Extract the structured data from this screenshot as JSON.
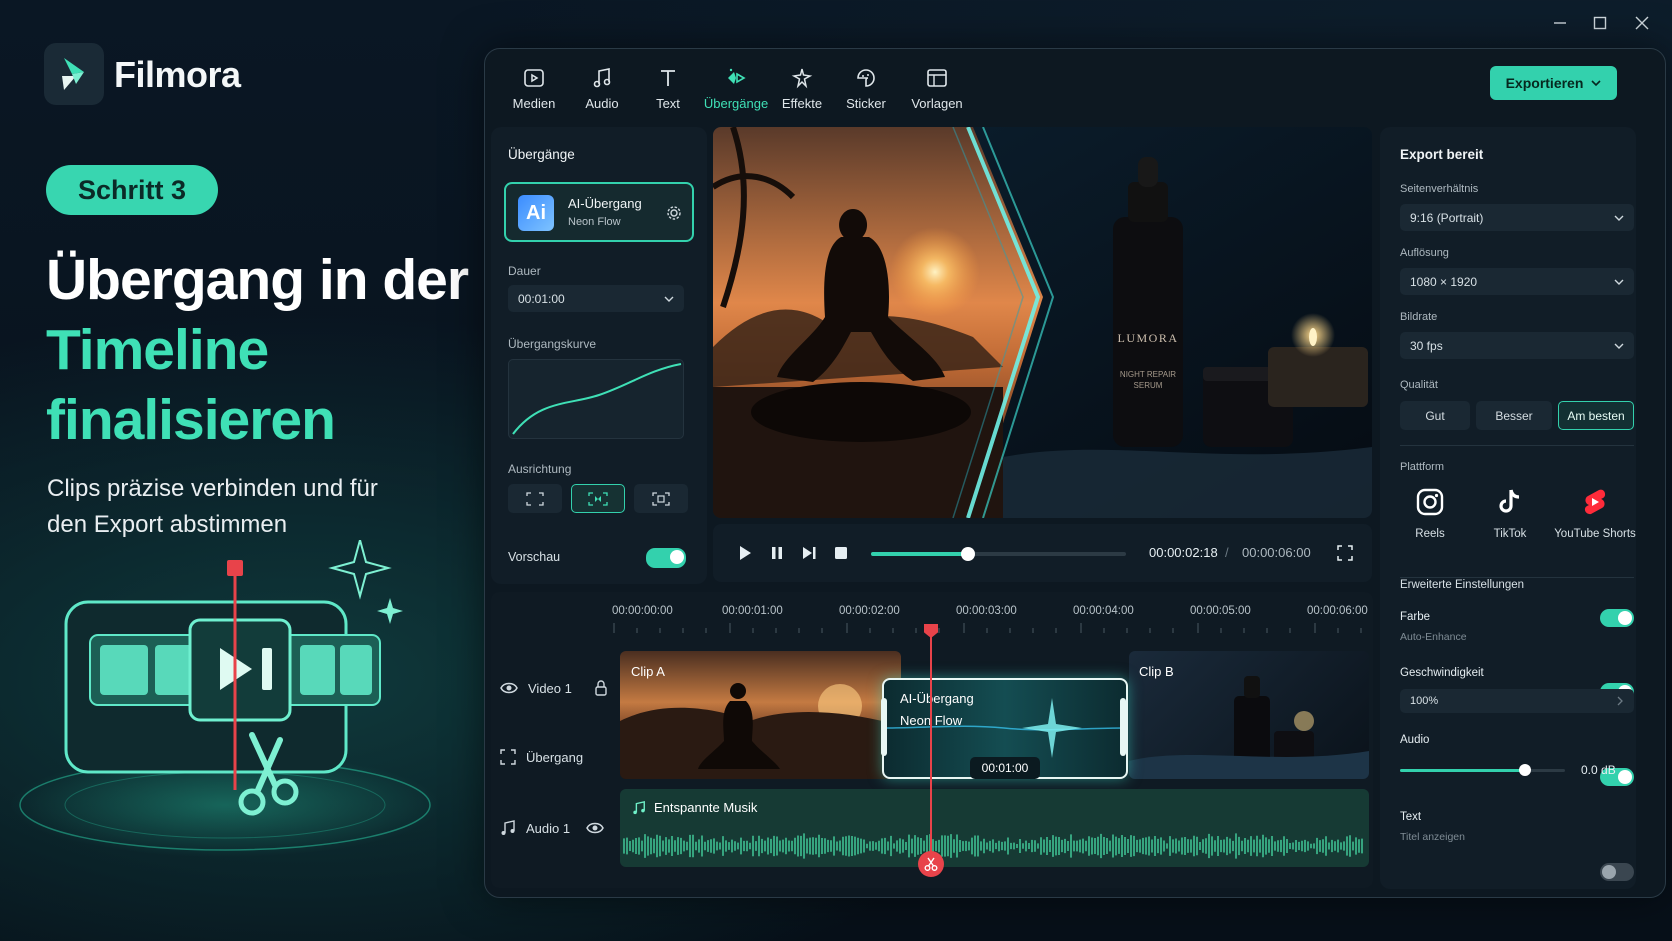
{
  "app": {
    "name": "Filmora"
  },
  "hero": {
    "step_badge": "Schritt 3",
    "headline_line1": "Übergang in der",
    "headline_line2": "Timeline",
    "headline_line3": "finalisieren",
    "subtitle": "Clips präzise verbinden und für den Export abstimmen"
  },
  "toolbar": {
    "tabs": [
      {
        "label": "Medien",
        "icon": "media-icon",
        "active": false
      },
      {
        "label": "Audio",
        "icon": "music-note-icon",
        "active": false
      },
      {
        "label": "Text",
        "icon": "text-icon",
        "active": false
      },
      {
        "label": "Übergänge",
        "icon": "transition-icon",
        "active": true
      },
      {
        "label": "Effekte",
        "icon": "effects-sparkle-icon",
        "active": false
      },
      {
        "label": "Sticker",
        "icon": "sticker-icon",
        "active": false
      },
      {
        "label": "Vorlagen",
        "icon": "templates-icon",
        "active": false
      }
    ],
    "export_label": "Exportieren"
  },
  "transitions_panel": {
    "title": "Übergänge",
    "card_badge": "Ai",
    "card_title": "AI-Übergang",
    "card_subtitle": "Neon Flow",
    "duration_label": "Dauer",
    "duration_value": "00:01:00",
    "curve_label": "Übergangskurve",
    "alignment_label": "Ausrichtung",
    "preview_label": "Vorschau",
    "preview_enabled": true
  },
  "preview": {
    "product_brand": "LUMORA",
    "product_line1": "NIGHT REPAIR",
    "product_line2": "SERUM",
    "current_time": "00:00:02:18",
    "separator": "/",
    "total_time": "00:00:06:00",
    "progress": 0.38
  },
  "export_panel": {
    "title": "Export bereit",
    "aspect_label": "Seitenverhältnis",
    "aspect_value": "9:16 (Portrait)",
    "resolution_label": "Auflösung",
    "resolution_value": "1080 × 1920",
    "framerate_label": "Bildrate",
    "framerate_value": "30 fps",
    "quality_label": "Qualität",
    "quality_options": [
      "Gut",
      "Besser",
      "Am besten"
    ],
    "quality_selected": "Am besten",
    "platform_label": "Plattform",
    "platforms": [
      {
        "label": "Reels",
        "icon": "instagram-icon"
      },
      {
        "label": "TikTok",
        "icon": "tiktok-icon"
      },
      {
        "label": "YouTube Shorts",
        "icon": "youtube-shorts-icon"
      }
    ],
    "advanced_label": "Erweiterte Einstellungen",
    "color_label": "Farbe",
    "color_sub": "Auto-Enhance",
    "color_enabled": true,
    "speed_label": "Geschwindigkeit",
    "speed_value": "100%",
    "speed_enabled": true,
    "audio_label": "Audio",
    "audio_value": "0.0 dB",
    "audio_enabled": true,
    "audio_level": 0.76,
    "text_label": "Text",
    "text_sub": "Titel anzeigen",
    "text_enabled": false
  },
  "timeline": {
    "ruler": [
      "00:00:00:00",
      "00:00:01:00",
      "00:00:02:00",
      "00:00:03:00",
      "00:00:04:00",
      "00:00:05:00",
      "00:00:06:00"
    ],
    "tracks": [
      {
        "label": "Video 1",
        "icon": "eye-icon"
      },
      {
        "label": "Übergang",
        "icon": "transition-box-icon"
      },
      {
        "label": "Audio 1",
        "icon": "music-note-icon"
      }
    ],
    "clip_a": "Clip A",
    "clip_b": "Clip B",
    "transition_title": "AI-Übergang",
    "transition_sub": "Neon Flow",
    "transition_duration": "00:01:00",
    "audio_clip": "Entspannte Musik"
  },
  "colors": {
    "accent": "#33d1ad",
    "playhead": "#e8434a",
    "bg": "#07121c"
  }
}
